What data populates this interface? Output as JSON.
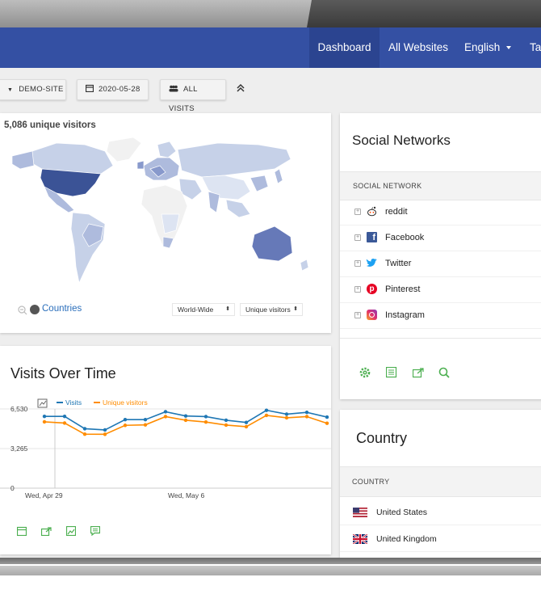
{
  "navbar": {
    "items": [
      {
        "label": "Dashboard",
        "active": true
      },
      {
        "label": "All Websites"
      },
      {
        "label": "English"
      },
      {
        "label": "Ta"
      }
    ],
    "color": "#3450a3"
  },
  "selectors": {
    "site": "DEMO-SITE",
    "date": "2020-05-28",
    "segment": "ALL VISITS"
  },
  "map_widget": {
    "headline": "5,086 unique visitors",
    "countries_link": "Countries",
    "region": "World-Wide",
    "metric": "Unique visitors"
  },
  "visits_over_time": {
    "title": "Visits Over Time",
    "legend": [
      {
        "name": "Visits",
        "color": "#1f77b4"
      },
      {
        "name": "Unique visitors",
        "color": "#ff8c00"
      }
    ],
    "y_ticks": [
      "6,530",
      "3,265",
      "0"
    ],
    "x_ticks": [
      "Wed, Apr 29",
      "Wed, May 6"
    ]
  },
  "chart_data": {
    "type": "line",
    "x": [
      "Apr 29",
      "Apr 30",
      "May 1",
      "May 2",
      "May 3",
      "May 4",
      "May 5",
      "May 6",
      "May 7",
      "May 8",
      "May 9",
      "May 10",
      "May 11",
      "May 12",
      "May 13",
      "May 14",
      "May 15",
      "May 16"
    ],
    "series": [
      {
        "name": "Visits",
        "values": [
          5920,
          5920,
          4900,
          4800,
          5650,
          5650,
          6300,
          5950,
          5900,
          5600,
          5420,
          6420,
          6100,
          6250,
          5860
        ]
      },
      {
        "name": "Unique visitors",
        "values": [
          5470,
          5370,
          4450,
          4440,
          5180,
          5220,
          5900,
          5600,
          5450,
          5200,
          5070,
          6000,
          5800,
          5900,
          5350
        ]
      }
    ],
    "title": "Visits Over Time",
    "ylim": [
      0,
      6530
    ],
    "x_tick_labels": [
      "Wed, Apr 29",
      "Wed, May 6"
    ],
    "y_tick_labels": [
      "6,530",
      "3,265",
      "0"
    ],
    "legend": "top-left",
    "grid": true
  },
  "social_networks": {
    "title": "Social Networks",
    "column_header": "SOCIAL NETWORK",
    "rows": [
      {
        "label": "reddit",
        "icon": "reddit-icon"
      },
      {
        "label": "Facebook",
        "icon": "facebook-icon"
      },
      {
        "label": "Twitter",
        "icon": "twitter-icon"
      },
      {
        "label": "Pinterest",
        "icon": "pinterest-icon"
      },
      {
        "label": "Instagram",
        "icon": "instagram-icon"
      }
    ]
  },
  "country": {
    "title": "Country",
    "column_header": "COUNTRY",
    "rows": [
      {
        "label": "United States",
        "flag": "us-flag-icon"
      },
      {
        "label": "United Kingdom",
        "flag": "uk-flag-icon"
      }
    ]
  }
}
